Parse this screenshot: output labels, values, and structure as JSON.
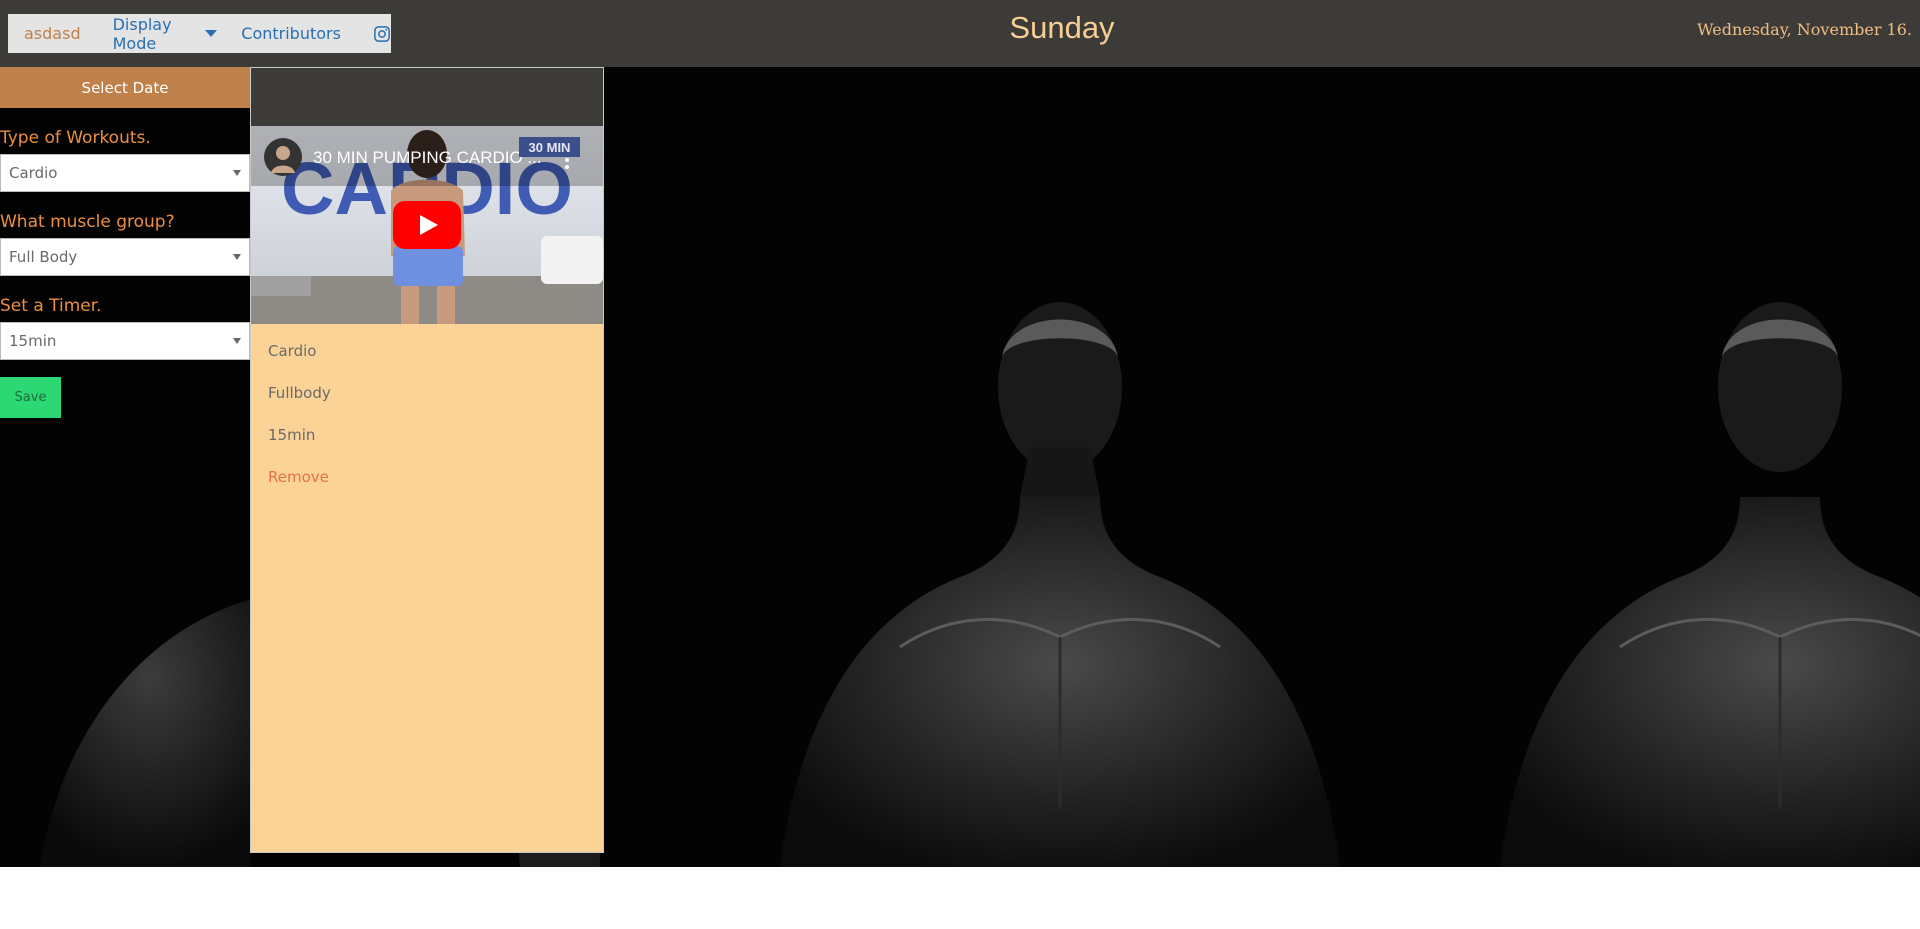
{
  "nav": {
    "brand": "asdasd",
    "display_mode": "Display Mode",
    "contributors": "Contributors"
  },
  "header": {
    "day": "Sunday",
    "date": "Wednesday, November 16."
  },
  "sidebar": {
    "select_date": "Select Date",
    "workout_label": "Type of Workouts.",
    "workout_value": "Cardio",
    "muscle_label": "What muscle group?",
    "muscle_value": "Full Body",
    "timer_label": "Set a Timer.",
    "timer_value": "15min",
    "save": "Save"
  },
  "card": {
    "video_title": "30 MIN PUMPING CARDIO ...",
    "video_badge": "30 MIN",
    "video_big_text": "CARDIO",
    "items": [
      "Cardio",
      "Fullbody",
      "15min"
    ],
    "remove": "Remove"
  },
  "colors": {
    "topbar": "#3d3b38",
    "accent": "#c0804a",
    "title": "#f7cf94",
    "card": "#fcd397",
    "save": "#2bd873",
    "remove": "#e6704c"
  },
  "icons": {
    "instagram": "instagram-icon",
    "play": "youtube-play-icon",
    "more": "more-vertical-icon",
    "caret": "caret-down-icon"
  }
}
